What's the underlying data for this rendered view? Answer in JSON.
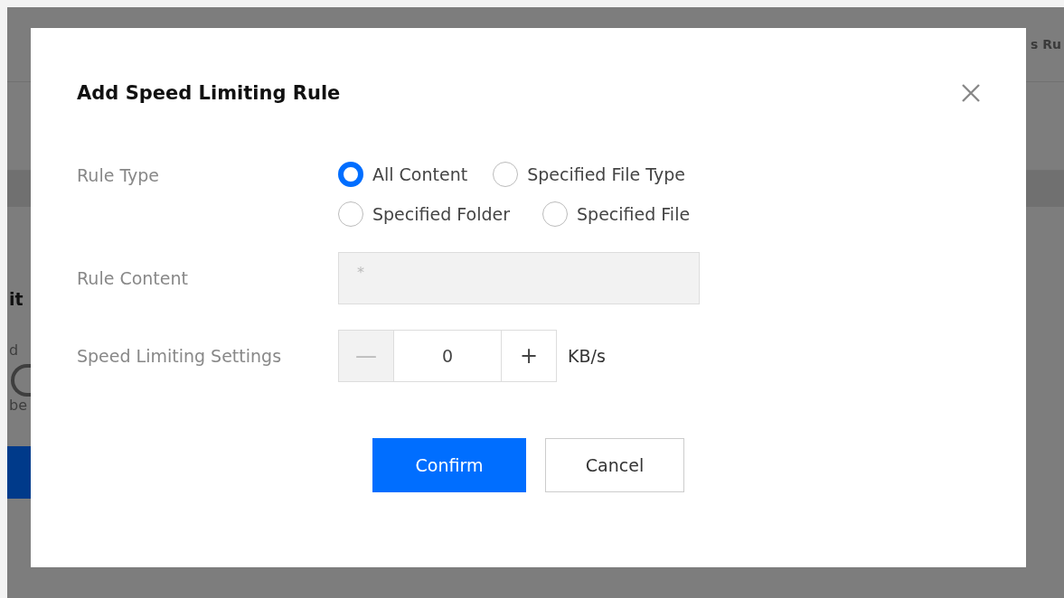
{
  "background": {
    "heading_fragment": "s Ru",
    "left_fragments": [
      {
        "text": "it",
        "kind": "heading"
      },
      {
        "text": "d",
        "kind": "text"
      },
      {
        "kind": "ring"
      },
      {
        "text": "be",
        "kind": "text"
      },
      {
        "kind": "button"
      }
    ]
  },
  "dialog": {
    "title": "Add Speed Limiting Rule",
    "rule_type": {
      "label": "Rule Type",
      "options": [
        {
          "label": "All Content",
          "selected": true
        },
        {
          "label": "Specified File Type",
          "selected": false
        },
        {
          "label": "Specified Folder",
          "selected": false
        },
        {
          "label": "Specified File",
          "selected": false
        }
      ]
    },
    "rule_content": {
      "label": "Rule Content",
      "value": "*",
      "disabled": true
    },
    "speed": {
      "label": "Speed Limiting Settings",
      "minus": "—",
      "value": "0",
      "plus": "+",
      "unit": "KB/s",
      "minus_disabled": true
    },
    "buttons": [
      {
        "label": "Confirm",
        "kind": "primary"
      },
      {
        "label": "Cancel",
        "kind": "secondary"
      }
    ]
  }
}
